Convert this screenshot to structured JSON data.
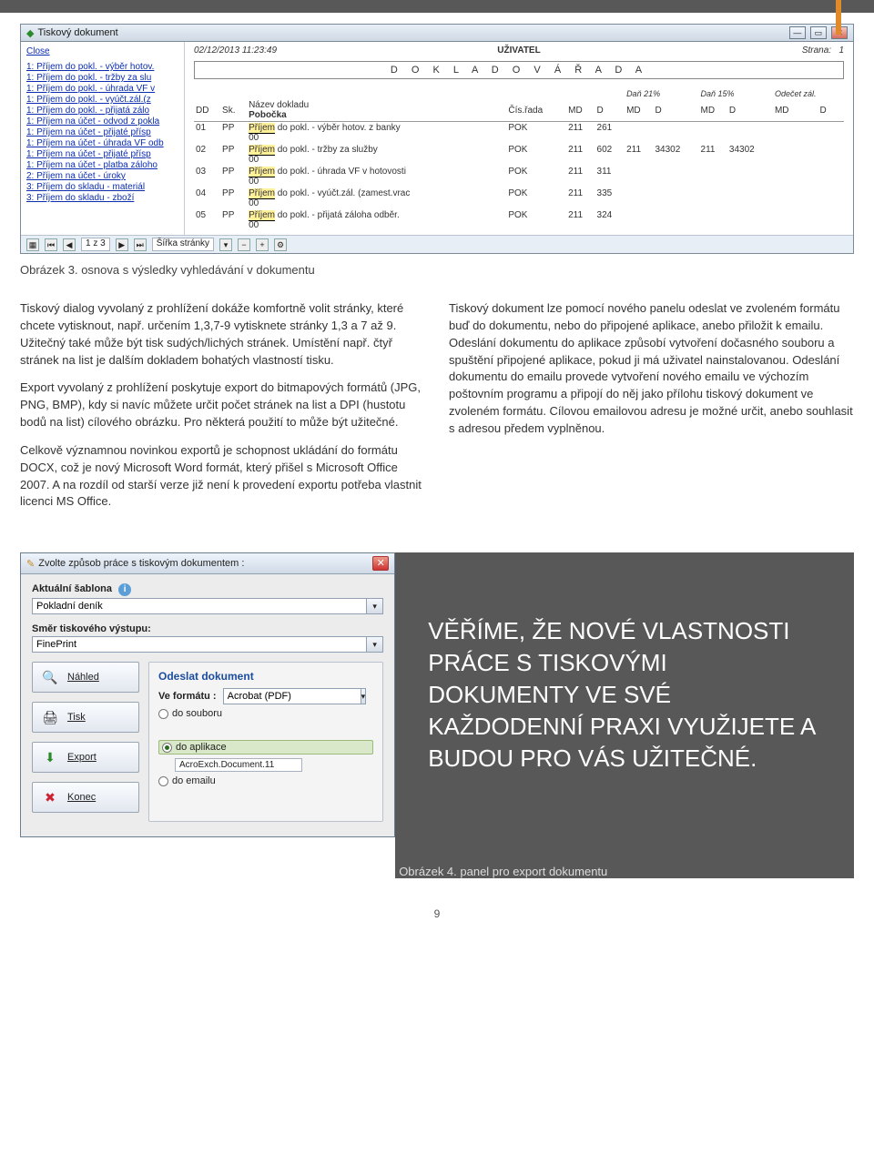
{
  "topbar": {
    "title": "Tiskový dokument"
  },
  "sidebar": {
    "close": "Close",
    "items": [
      "1: Příjem do pokl. - výběr hotov.",
      "1: Příjem do pokl. - tržby za slu",
      "1: Příjem do pokl. - úhrada VF v",
      "1: Příjem do pokl. - vyúčt.zál.(z",
      "1: Příjem do pokl. - přijatá zálo",
      "1: Příjem na účet - odvod z pokla",
      "1: Příjem na účet - přijaté přísp",
      "1: Příjem na účet - úhrada VF odb",
      "1: Příjem na účet - přijaté přísp",
      "1: Příjem na účet - platba záloho",
      "2: Příjem na účet - úroky",
      "3: Příjem do skladu - materiál",
      "3: Příjem do skladu - zboží"
    ]
  },
  "report": {
    "datetime": "02/12/2013  11:23:49",
    "user_label": "UŽIVATEL",
    "page_label": "Strana:",
    "page_num": "1",
    "box_title": "D O K L A D O V Á   Ř A D A",
    "cols": {
      "dd": "DD",
      "sk": "Sk.",
      "nazev": "Název dokladu",
      "pobocka": "Pobočka",
      "cisr": "Čís.řada",
      "md": "MD",
      "d": "D",
      "g1": "",
      "g2": "Daň 21%",
      "g3": "Daň 15%",
      "g4": "Odečet zál."
    },
    "rows": [
      {
        "dd": "01",
        "sk": "PP",
        "nazev": "Příjem do pokl. - výběr hotov. z banky",
        "sub": "00",
        "cisr": "POK",
        "md": "211",
        "d": "261",
        "d21md": "",
        "d21d": "",
        "d15md": "",
        "d15d": "",
        "ozmd": "",
        "ozd": ""
      },
      {
        "dd": "02",
        "sk": "PP",
        "nazev": "Příjem do pokl. - tržby za služby",
        "sub": "00",
        "cisr": "POK",
        "md": "211",
        "d": "602",
        "d21md": "211",
        "d21d": "34302",
        "d15md": "211",
        "d15d": "34302",
        "ozmd": "",
        "ozd": ""
      },
      {
        "dd": "03",
        "sk": "PP",
        "nazev": "Příjem do pokl. - úhrada VF v hotovosti",
        "sub": "00",
        "cisr": "POK",
        "md": "211",
        "d": "311",
        "d21md": "",
        "d21d": "",
        "d15md": "",
        "d15d": "",
        "ozmd": "",
        "ozd": ""
      },
      {
        "dd": "04",
        "sk": "PP",
        "nazev": "Příjem do pokl. - vyúčt.zál. (zamest.vrac",
        "sub": "00",
        "cisr": "POK",
        "md": "211",
        "d": "335",
        "d21md": "",
        "d21d": "",
        "d15md": "",
        "d15d": "",
        "ozmd": "",
        "ozd": ""
      },
      {
        "dd": "05",
        "sk": "PP",
        "nazev": "Příjem do pokl. - přijatá záloha odběr.",
        "sub": "00",
        "cisr": "POK",
        "md": "211",
        "d": "324",
        "d21md": "",
        "d21d": "",
        "d15md": "",
        "d15d": "",
        "ozmd": "",
        "ozd": ""
      }
    ]
  },
  "status": {
    "pageinfo": "1 z 3",
    "zoomlabel": "Šířka stránky"
  },
  "caption1": "Obrázek 3. osnova s výsledky vyhledávání v dokumentu",
  "article": {
    "left": [
      "Tiskový dialog vyvolaný z prohlížení dokáže komfortně volit stránky, které chcete vytisknout, např. určením 1,3,7-9 vytisknete stránky 1,3 a 7 až 9. Užitečný také může být tisk sudých/lichých stránek. Umístění např. čtyř stránek na list je dalším dokladem bohatých vlastností tisku.",
      "Export vyvolaný z prohlížení poskytuje export do bitmapových formátů (JPG, PNG, BMP), kdy si navíc můžete určit počet stránek na list a DPI (hustotu bodů na list) cílového obrázku. Pro některá použití to může být užitečné.",
      "Celkově významnou novinkou exportů je schopnost ukládání do formátu DOCX, což je nový Microsoft Word formát, který přišel s Microsoft Office 2007. A na rozdíl od starší verze již není k provedení exportu potřeba vlastnit licenci MS Office."
    ],
    "right": [
      "Tiskový dokument lze pomocí nového panelu odeslat ve zvoleném formátu buď do dokumentu, nebo do připojené aplikace, anebo přiložit k emailu. Odeslání dokumentu do aplikace způsobí vytvoření dočasného souboru a spuštění připojené aplikace, pokud ji má uživatel nainstalovanou. Odeslání dokumentu do emailu provede vytvoření nového emailu ve výchozím poštovním programu a připojí do něj jako přílohu tiskový dokument ve zvoleném formátu. Cílovou emailovou adresu je možné určit, anebo souhlasit s adresou předem vyplněnou."
    ]
  },
  "dialog": {
    "title": "Zvolte způsob práce s tiskovým dokumentem :",
    "template_label": "Aktuální šablona",
    "template_value": "Pokladní deník",
    "output_label": "Směr tiskového výstupu:",
    "output_value": "FinePrint",
    "buttons": {
      "nahled": "Náhled",
      "tisk": "Tisk",
      "export": "Export",
      "konec": "Konec"
    },
    "send": {
      "title": "Odeslat dokument",
      "format_label": "Ve formátu :",
      "format_value": "Acrobat (PDF)",
      "opt_file": "do souboru",
      "opt_app": "do aplikace",
      "app_value": "AcroExch.Document.11",
      "opt_email": "do emailu"
    }
  },
  "quote": "VĚŘÍME, ŽE NOVÉ VLASTNOSTI PRÁCE S TISKOVÝMI DOKUMENTY VE SVÉ KAŽDODENNÍ PRAXI VYUŽIJETE A BUDOU PRO VÁS UŽITEČNÉ.",
  "caption2": "Obrázek 4. panel pro export dokumentu",
  "pagenum": "9"
}
